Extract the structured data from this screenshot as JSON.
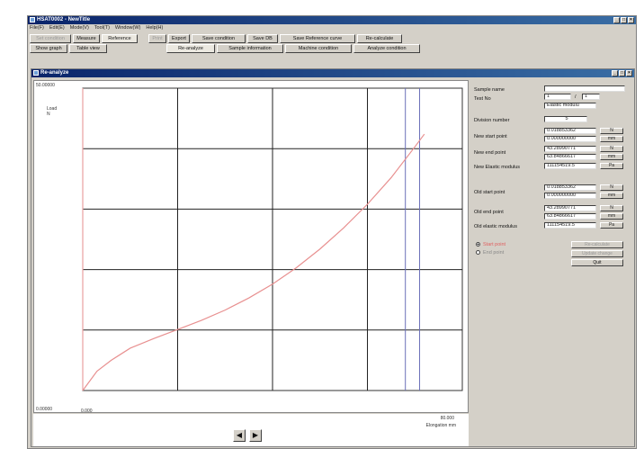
{
  "app": {
    "title": "HSAT0002 - NewTitle",
    "window_controls": [
      "_",
      "□",
      "×"
    ],
    "menu": [
      "File(F)",
      "Edit(E)",
      "Mode(V)",
      "Tool(T)",
      "Window(W)",
      "Help(H)"
    ]
  },
  "toolbar": {
    "row1": [
      {
        "label": "Set condition",
        "enabled": false
      },
      {
        "label": "Measure",
        "enabled": true
      },
      {
        "label": "Reference",
        "enabled": true,
        "active": true
      },
      {
        "label": "Print",
        "enabled": false
      },
      {
        "label": "Export",
        "enabled": true
      },
      {
        "label": "Save condition",
        "enabled": true
      },
      {
        "label": "Save DB",
        "enabled": true
      },
      {
        "label": "Save Reference curve",
        "enabled": true
      },
      {
        "label": "Re-calculate",
        "enabled": true
      }
    ],
    "row2": [
      {
        "label": "Show graph",
        "enabled": true
      },
      {
        "label": "Table view",
        "enabled": true
      },
      {
        "label": "Re-analyze",
        "enabled": true,
        "active": true
      },
      {
        "label": "Sample information",
        "enabled": true
      },
      {
        "label": "Machine condition",
        "enabled": true
      },
      {
        "label": "Analyze condition",
        "enabled": true
      }
    ]
  },
  "child_window": {
    "title": "Re-analyze",
    "window_controls": [
      "_",
      "□",
      "×"
    ]
  },
  "chart_data": {
    "type": "line",
    "ylabel": "Load",
    "yunit": "N",
    "xlabel": "Elongation mm",
    "ylim_labels": [
      "0.00000",
      "50.00000"
    ],
    "xlim_labels": [
      "0.000",
      "80.000"
    ],
    "ylim": [
      0,
      50
    ],
    "xlim": [
      0,
      80
    ],
    "grid": true,
    "series": [
      {
        "color": "#e89090",
        "x": [
          0,
          3,
          6,
          10,
          15,
          20,
          25,
          30,
          35,
          40,
          45,
          50,
          55,
          60,
          65,
          70,
          72
        ],
        "y": [
          0,
          3.2,
          5.0,
          7.0,
          8.6,
          10.1,
          11.6,
          13.3,
          15.3,
          17.6,
          20.3,
          23.4,
          26.9,
          30.8,
          35.2,
          40.3,
          42.4
        ]
      }
    ],
    "markers": {
      "start_line_x": 68,
      "end_line_x": 71
    }
  },
  "panel": {
    "sample_name_label": "Sample name",
    "sample_name_value": "",
    "test_no_label": "Test No",
    "test_no_value": "1",
    "test_no_sep": "/",
    "test_no_total": "1",
    "analysis_select": "Elastic modulu",
    "division_number_label": "Division number",
    "division_number_value": "5",
    "new_start_label": "New start point",
    "new_start_values": [
      "0.018853362",
      "0.000000000"
    ],
    "new_start_units": [
      "N",
      "mm"
    ],
    "new_end_label": "New end point",
    "new_end_values": [
      "43.28990771",
      "63.84866617"
    ],
    "new_end_units": [
      "N",
      "mm"
    ],
    "new_elastic_label": "New Elastic modulus",
    "new_elastic_value": "111154519.5",
    "new_elastic_unit": "Pa",
    "old_start_label": "Old start point",
    "old_start_values": [
      "0.018853362",
      "0.000000000"
    ],
    "old_start_units": [
      "N",
      "mm"
    ],
    "old_end_label": "Old end point",
    "old_end_values": [
      "43.28990771",
      "63.84866617"
    ],
    "old_end_units": [
      "N",
      "mm"
    ],
    "old_elastic_label": "Old elastic modulus",
    "old_elastic_value": "111154519.5",
    "old_elastic_unit": "Pa",
    "radio_start": "Start point",
    "radio_end": "End point",
    "btn_recalc": "Re-calculate",
    "btn_update": "Update change",
    "btn_quit": "Quit"
  },
  "nav": {
    "prev": "◀",
    "next": "▶"
  }
}
